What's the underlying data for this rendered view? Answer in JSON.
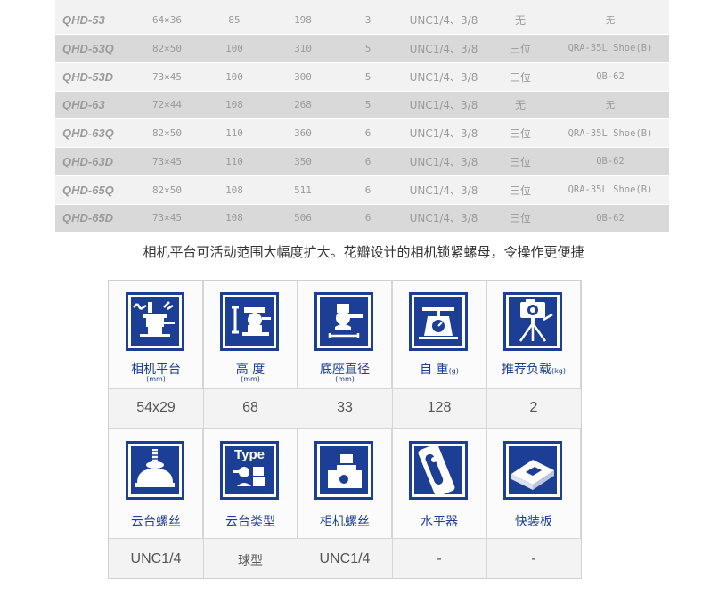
{
  "spec_table": {
    "rows": [
      {
        "model": "QHD-53",
        "size": "64×36",
        "height": "85",
        "weight": "198",
        "load": "3",
        "thread": "UNC1/4、3/8",
        "level": "无",
        "plate": "无"
      },
      {
        "model": "QHD-53Q",
        "size": "82×50",
        "height": "100",
        "weight": "310",
        "load": "5",
        "thread": "UNC1/4、3/8",
        "level": "三位",
        "plate": "QRA-35L Shoe(B)"
      },
      {
        "model": "QHD-53D",
        "size": "73×45",
        "height": "100",
        "weight": "300",
        "load": "5",
        "thread": "UNC1/4、3/8",
        "level": "三位",
        "plate": "QB-62"
      },
      {
        "model": "QHD-63",
        "size": "72×44",
        "height": "108",
        "weight": "268",
        "load": "5",
        "thread": "UNC1/4、3/8",
        "level": "无",
        "plate": "无"
      },
      {
        "model": "QHD-63Q",
        "size": "82×50",
        "height": "110",
        "weight": "360",
        "load": "6",
        "thread": "UNC1/4、3/8",
        "level": "三位",
        "plate": "QRA-35L Shoe(B)"
      },
      {
        "model": "QHD-63D",
        "size": "73×45",
        "height": "110",
        "weight": "350",
        "load": "6",
        "thread": "UNC1/4、3/8",
        "level": "三位",
        "plate": "QB-62"
      },
      {
        "model": "QHD-65Q",
        "size": "82×50",
        "height": "108",
        "weight": "511",
        "load": "6",
        "thread": "UNC1/4、3/8",
        "level": "三位",
        "plate": "QRA-35L Shoe(B)"
      },
      {
        "model": "QHD-65D",
        "size": "73×45",
        "height": "108",
        "weight": "506",
        "load": "6",
        "thread": "UNC1/4、3/8",
        "level": "三位",
        "plate": "QB-62"
      }
    ]
  },
  "caption": "相机平台可活动范围大幅度扩大。花瓣设计的相机锁紧螺母，令操作更便捷",
  "grid": {
    "row1": [
      {
        "icon": "camera-platform-icon",
        "label": "相机平台",
        "unit": "(mm)",
        "value": "54x29"
      },
      {
        "icon": "height-icon",
        "label": "高  度",
        "unit": "(mm)",
        "value": "68"
      },
      {
        "icon": "base-diameter-icon",
        "label": "底座直径",
        "unit": "(mm)",
        "value": "33"
      },
      {
        "icon": "scale-icon",
        "label": "自  重",
        "unit": "(g)",
        "value": "128"
      },
      {
        "icon": "tripod-camera-icon",
        "label": "推荐负载",
        "unit": "(kg)",
        "value": "2"
      }
    ],
    "row2": [
      {
        "icon": "head-screw-icon",
        "label": "云台螺丝",
        "value": "UNC1/4"
      },
      {
        "icon": "head-type-icon",
        "label": "云台类型",
        "value": "球型",
        "icon_text": "Type"
      },
      {
        "icon": "camera-screw-icon",
        "label": "相机螺丝",
        "value": "UNC1/4"
      },
      {
        "icon": "spirit-level-icon",
        "label": "水平器",
        "value": "-"
      },
      {
        "icon": "quick-plate-icon",
        "label": "快装板",
        "value": "-"
      }
    ]
  },
  "colors": {
    "accent": "#1c3f95",
    "text": "#555555"
  }
}
